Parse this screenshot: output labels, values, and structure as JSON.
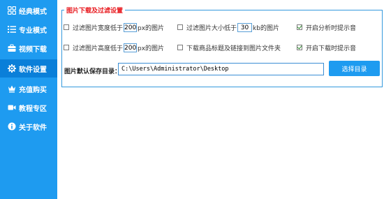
{
  "sidebar": {
    "items": [
      {
        "label": "经典模式",
        "icon": "grid-icon",
        "active": false
      },
      {
        "label": "专业模式",
        "icon": "list-icon",
        "active": false
      },
      {
        "label": "视频下载",
        "icon": "briefcase-icon",
        "active": false
      },
      {
        "label": "软件设置",
        "icon": "gear-icon",
        "active": true
      },
      {
        "label": "充值购买",
        "icon": "crown-icon",
        "active": false
      },
      {
        "label": "教程专区",
        "icon": "video-icon",
        "active": false
      },
      {
        "label": "关于软件",
        "icon": "info-icon",
        "active": false
      }
    ]
  },
  "settings": {
    "group_title": "图片下载及过滤设置",
    "filter_width": {
      "prefix": "过滤图片宽度低于",
      "value": "200",
      "suffix": "px的图片",
      "checked": false
    },
    "filter_size": {
      "prefix": "过滤图片大小低于",
      "value": "30",
      "suffix": "kb的图片",
      "checked": false
    },
    "analysis_sound": {
      "label": "开启分析时提示音",
      "checked": true
    },
    "filter_height": {
      "prefix": "过滤图片高度低于",
      "value": "200",
      "suffix": "px的图片",
      "checked": false
    },
    "download_title_link": {
      "label": "下载商品标题及链接到图片文件夹",
      "checked": false
    },
    "download_sound": {
      "label": "开启下载时提示音",
      "checked": true
    },
    "save_path_label": "图片默认保存目录：",
    "save_path_value": "C:\\Users\\Administrator\\Desktop",
    "browse_button": "选择目录"
  },
  "colors": {
    "sidebar_bg": "#1e9bf0",
    "sidebar_active": "#0a7fd9",
    "accent_red": "#e8191e"
  }
}
